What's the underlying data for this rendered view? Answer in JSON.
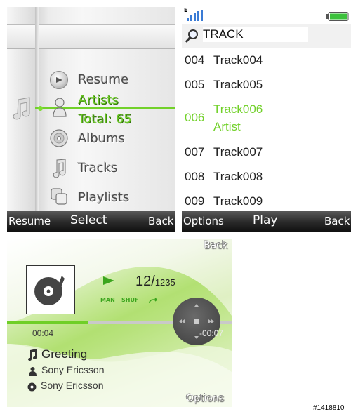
{
  "menu": {
    "items": [
      {
        "label": "Resume",
        "icon": "play-disc-icon"
      },
      {
        "label": "Artists",
        "icon": "person-icon",
        "selected": true
      },
      {
        "label": "Albums",
        "icon": "cd-icon"
      },
      {
        "label": "Tracks",
        "icon": "music-note-icon"
      },
      {
        "label": "Playlists",
        "icon": "playlist-icon"
      }
    ],
    "total_label": "Total: 65",
    "softkeys": {
      "left": "Resume",
      "center": "Select",
      "right": "Back"
    }
  },
  "tracklist": {
    "status_badge": "E",
    "search_text": "TRACK",
    "rows": [
      {
        "num": "004",
        "name": "Track004"
      },
      {
        "num": "005",
        "name": "Track005"
      },
      {
        "num": "006",
        "name": "Track006",
        "artist": "Artist",
        "selected": true
      },
      {
        "num": "007",
        "name": "Track007"
      },
      {
        "num": "008",
        "name": "Track008"
      },
      {
        "num": "009",
        "name": "Track009"
      }
    ],
    "softkeys": {
      "left": "Options",
      "center": "Play",
      "right": "Back"
    }
  },
  "player": {
    "back_label": "Back",
    "track_position": "12/",
    "track_total": "1235",
    "modes": {
      "man": "MAN",
      "shuf": "SHUF"
    },
    "elapsed": "00:04",
    "remaining": "-00:07",
    "progress": 0.36,
    "song_title": "Greeting",
    "artist": "Sony Ericsson",
    "album": "Sony Ericsson",
    "options_label": "Options"
  },
  "watermark": "#1418810",
  "colors": {
    "accent": "#72d12a",
    "softbar": "#2a2a2a"
  }
}
